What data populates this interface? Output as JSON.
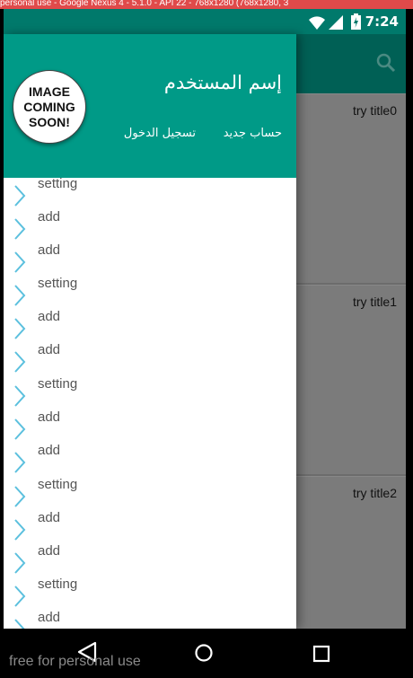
{
  "emulator_banner": "personal use - Google Nexus 4 - 5.1.0 - API 22 - 768x1280 (768x1280, 3",
  "status_bar": {
    "time": "7:24",
    "icons": [
      "wifi-icon",
      "signal-icon",
      "battery-icon"
    ]
  },
  "toolbar": {
    "search_icon": "search-icon"
  },
  "cards": [
    {
      "title": "try title0"
    },
    {
      "title": "try title1"
    },
    {
      "title": "try title2"
    }
  ],
  "drawer": {
    "avatar": {
      "line1": "IMAGE",
      "line2": "COMING",
      "line3": "SOON!"
    },
    "username": "إسم المستخدم",
    "signup_label": "حساب جديد",
    "login_label": "تسجيل الدخول",
    "menu_items": [
      {
        "label": "setting"
      },
      {
        "label": "add"
      },
      {
        "label": "add"
      },
      {
        "label": "setting"
      },
      {
        "label": "add"
      },
      {
        "label": "add"
      },
      {
        "label": "setting"
      },
      {
        "label": "add"
      },
      {
        "label": "add"
      },
      {
        "label": "setting"
      },
      {
        "label": "add"
      },
      {
        "label": "add"
      },
      {
        "label": "setting"
      },
      {
        "label": "add"
      }
    ]
  },
  "nav_bar": {
    "buttons": [
      "back-icon",
      "home-icon",
      "recent-apps-icon"
    ]
  },
  "watermark": "free for personal use",
  "colors": {
    "status_bar": "#00796b",
    "app_bar": "#006055",
    "drawer_header": "#009a87",
    "chevron": "#5bc0de"
  }
}
